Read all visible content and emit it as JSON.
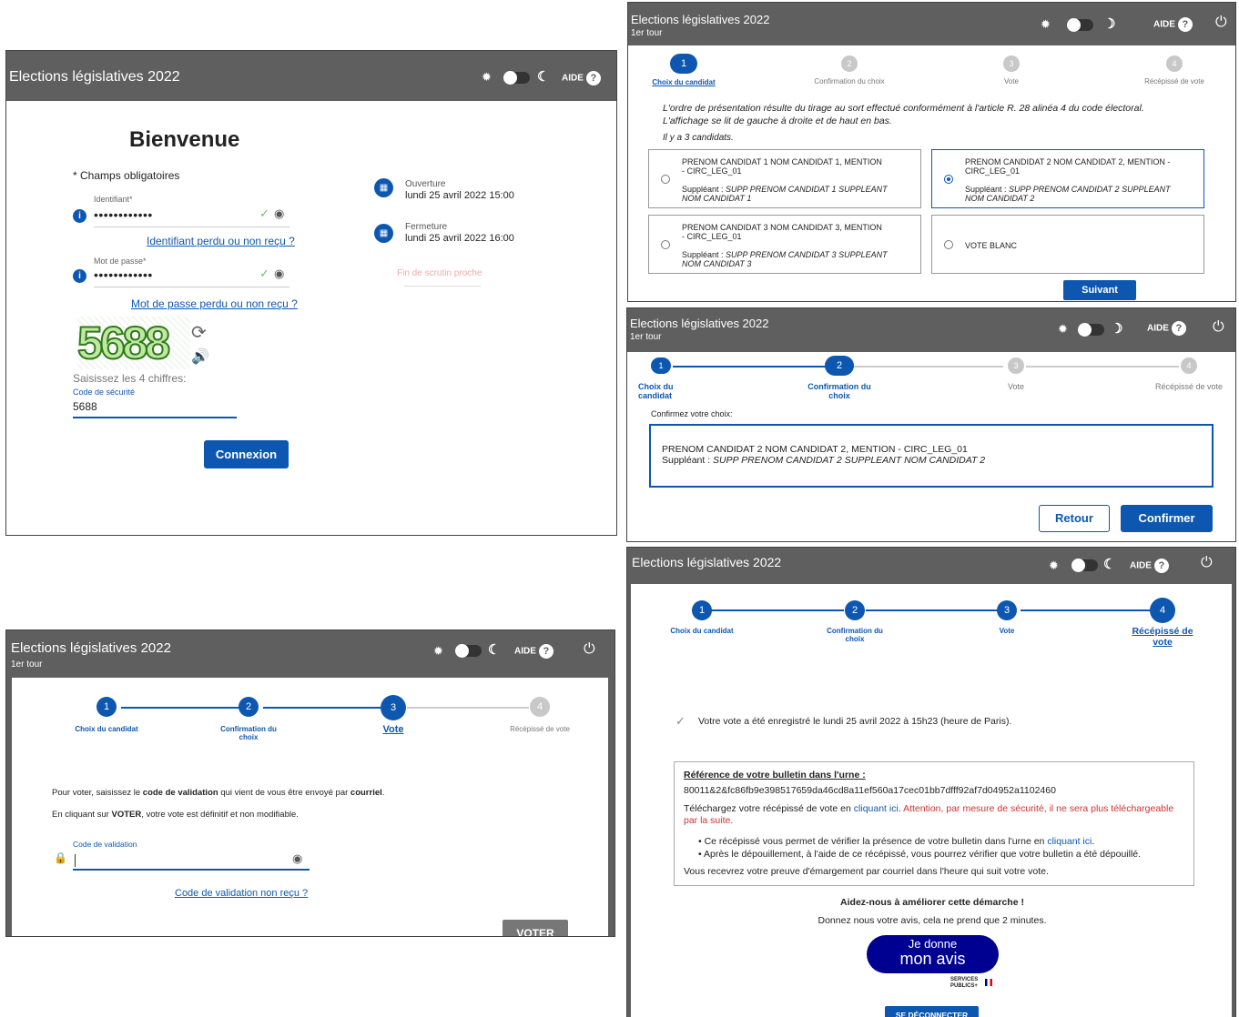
{
  "app_title": "Elections législatives 2022",
  "round": "1er tour",
  "aide_label": "AIDE",
  "icons": {
    "theme_light": "sun-icon",
    "theme_dark": "moon-icon",
    "help": "help-icon",
    "power": "power-icon"
  },
  "colors": {
    "primary": "#0d57b0",
    "header": "#5f5f5f",
    "warning": "#d32f2f"
  },
  "steps": [
    {
      "num": "1",
      "label": "Choix du candidat"
    },
    {
      "num": "2",
      "label": "Confirmation du choix"
    },
    {
      "num": "3",
      "label": "Vote"
    },
    {
      "num": "4",
      "label": "Récépissé de vote"
    }
  ],
  "login": {
    "welcome": "Bienvenue",
    "required_note": "* Champs obligatoires",
    "identifiant_label": "Identifiant*",
    "identifiant_value": "••••••••••••",
    "identifiant_lost": "Identifiant perdu ou non reçu ?",
    "password_label": "Mot de passe*",
    "password_value": "••••••••••••",
    "password_lost": "Mot de passe perdu ou non reçu ?",
    "captcha_image": "5688",
    "captcha_prompt": "Saisissez les 4 chiffres:",
    "captcha_label": "Code de sécurité",
    "captcha_value": "5688",
    "connect_button": "Connexion",
    "opening_label": "Ouverture",
    "opening_value": "lundi 25 avril 2022 15:00",
    "closing_label": "Fermeture",
    "closing_value": "lundi 25 avril 2022 16:00",
    "end_soon": "Fin de scrutin proche"
  },
  "choice": {
    "intro": "L'ordre de présentation résulte du tirage au sort effectué conformément à l'article R. 28 alinéa 4 du code électoral. L'affichage se lit de gauche à droite et de haut en bas.",
    "count": "Il y a 3 candidats.",
    "supp_prefix": "Suppléant : ",
    "candidates": [
      {
        "name": "PRENOM CANDIDAT 1 NOM CANDIDAT 1, MENTION - CIRC_LEG_01",
        "supp": "SUPP PRENOM CANDIDAT 1 SUPPLEANT NOM CANDIDAT 1"
      },
      {
        "name": "PRENOM CANDIDAT 2 NOM CANDIDAT 2, MENTION - CIRC_LEG_01",
        "supp": "SUPP PRENOM CANDIDAT 2 SUPPLEANT NOM CANDIDAT 2"
      },
      {
        "name": "PRENOM CANDIDAT 3 NOM CANDIDAT 3, MENTION - CIRC_LEG_01",
        "supp": "SUPP PRENOM CANDIDAT 3 SUPPLEANT NOM CANDIDAT 3"
      }
    ],
    "blank": "VOTE BLANC",
    "selected": "candidate-2",
    "next_button": "Suivant"
  },
  "confirm": {
    "prompt": "Confirmez votre choix:",
    "candidate": "PRENOM CANDIDAT 2 NOM CANDIDAT 2, MENTION - CIRC_LEG_01",
    "supp_prefix": "Suppléant : ",
    "supp": "SUPP PRENOM CANDIDAT 2 SUPPLEANT NOM CANDIDAT 2",
    "back_button": "Retour",
    "confirm_button": "Confirmer"
  },
  "vote": {
    "line1_a": "Pour voter, saisissez le ",
    "line1_b": "code de validation",
    "line1_c": " qui vient de vous être envoyé par ",
    "line1_d": "courriel",
    "line1_e": ".",
    "line2_a": "En cliquant sur ",
    "line2_b": "VOTER",
    "line2_c": ", votre vote est définitif et non modifiable.",
    "code_label": "Code de validation",
    "code_lost": "Code de validation non reçu ?",
    "vote_button": "VOTER"
  },
  "receipt": {
    "recorded": "Votre vote a été enregistré le lundi 25 avril 2022 à 15h23 (heure de Paris).",
    "ref_title": "Référence de votre bulletin dans l'urne :",
    "ref_value": "80011&2&fc86fb9e398517659da46cd8a11ef560a17cec01bb7dfff92af7d04952a1102460",
    "download_a": "Téléchargez votre récépissé de vote en ",
    "download_link": "cliquant ici",
    "download_b": ".",
    "warning": "Attention, par mesure de sécurité, il ne sera plus téléchargeable par la suite.",
    "bullet1_a": "Ce récépissé vous permet de vérifier la présence de votre bulletin dans l'urne en ",
    "bullet1_link": "cliquant ici",
    "bullet1_b": ".",
    "bullet2": "Après le dépouillement, à l'aide de ce récépissé, vous pourrez vérifier que votre bulletin a été dépouillé.",
    "proof": "Vous recevrez votre preuve d'émargement par courriel dans l'heure qui suit votre vote.",
    "help_title": "Aidez-nous à améliorer cette démarche !",
    "help_sub": "Donnez nous votre avis, cela ne prend que 2 minutes.",
    "avis_line1": "Je donne",
    "avis_line2": "mon avis",
    "avis_brand": "SERVICES PUBLICS+",
    "logout_button": "SE DÉCONNECTER"
  }
}
